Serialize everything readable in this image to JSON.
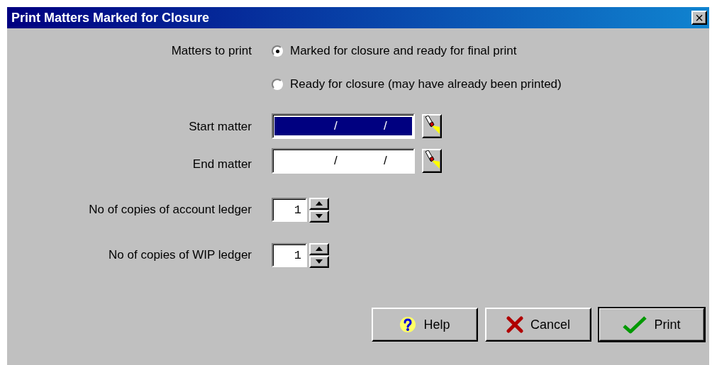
{
  "window": {
    "title": "Print Matters Marked for Closure",
    "close": "×"
  },
  "matters_to_print": {
    "label": "Matters to print",
    "options": [
      {
        "label": "Marked for closure and ready for final print",
        "selected": true
      },
      {
        "label": "Ready for closure (may have already been printed)",
        "selected": false
      }
    ]
  },
  "ranges": [
    {
      "label": "Start matter",
      "separators": [
        "/",
        "/"
      ],
      "selected": true
    },
    {
      "label": "End matter",
      "separators": [
        "/",
        "/"
      ],
      "selected": false
    }
  ],
  "copies": [
    {
      "label": "No of copies of account ledger",
      "value": "1"
    },
    {
      "label": "No of copies of WIP ledger",
      "value": "1"
    }
  ],
  "buttons": [
    {
      "kind": "help",
      "label": "Help",
      "default": false
    },
    {
      "kind": "cancel",
      "label": "Cancel",
      "default": false
    },
    {
      "kind": "print",
      "label": "Print",
      "default": true
    }
  ]
}
